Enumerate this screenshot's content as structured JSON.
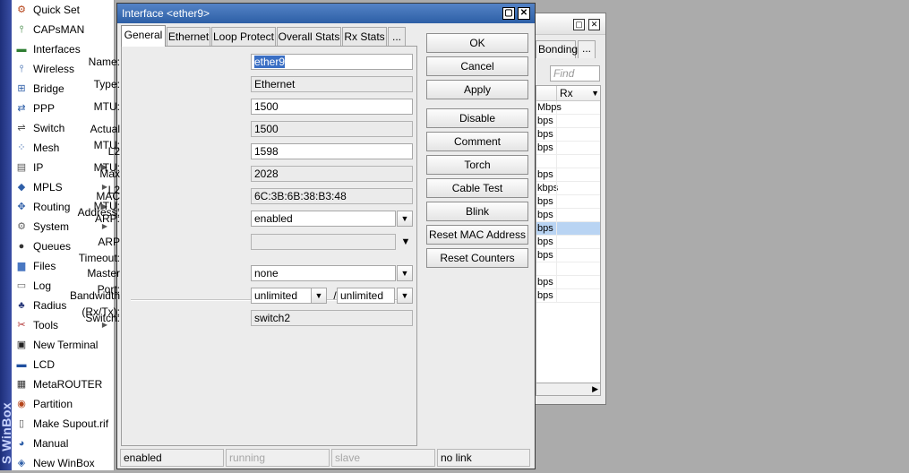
{
  "sidebar": {
    "brand": "S WinBox",
    "items": [
      {
        "label": "Quick Set",
        "icon": "quick-set-icon",
        "glyph": "⚙",
        "color": "#b5451b",
        "submenu": false
      },
      {
        "label": "CAPsMAN",
        "icon": "capsman-icon",
        "glyph": "⫯",
        "color": "#2f7d32",
        "submenu": false
      },
      {
        "label": "Interfaces",
        "icon": "interfaces-icon",
        "glyph": "▬",
        "color": "#2f7d32",
        "submenu": false
      },
      {
        "label": "Wireless",
        "icon": "wireless-icon",
        "glyph": "⫯",
        "color": "#2f5fa8",
        "submenu": false
      },
      {
        "label": "Bridge",
        "icon": "bridge-icon",
        "glyph": "⊞",
        "color": "#2f5fa8",
        "submenu": false
      },
      {
        "label": "PPP",
        "icon": "ppp-icon",
        "glyph": "⇄",
        "color": "#2f5fa8",
        "submenu": false
      },
      {
        "label": "Switch",
        "icon": "switch-icon",
        "glyph": "⇌",
        "color": "#555555",
        "submenu": false
      },
      {
        "label": "Mesh",
        "icon": "mesh-icon",
        "glyph": "⁘",
        "color": "#2f5fa8",
        "submenu": false
      },
      {
        "label": "IP",
        "icon": "ip-icon",
        "glyph": "▤",
        "color": "#555555",
        "submenu": true
      },
      {
        "label": "MPLS",
        "icon": "mpls-icon",
        "glyph": "◆",
        "color": "#2f5fa8",
        "submenu": true
      },
      {
        "label": "Routing",
        "icon": "routing-icon",
        "glyph": "✥",
        "color": "#2f5fa8",
        "submenu": true
      },
      {
        "label": "System",
        "icon": "system-icon",
        "glyph": "⚙",
        "color": "#666666",
        "submenu": true
      },
      {
        "label": "Queues",
        "icon": "queues-icon",
        "glyph": "●",
        "color": "#333333",
        "submenu": false
      },
      {
        "label": "Files",
        "icon": "files-icon",
        "glyph": "▆",
        "color": "#4a78c2",
        "submenu": false
      },
      {
        "label": "Log",
        "icon": "log-icon",
        "glyph": "▭",
        "color": "#666666",
        "submenu": false
      },
      {
        "label": "Radius",
        "icon": "radius-icon",
        "glyph": "♣",
        "color": "#2a3a7a",
        "submenu": false
      },
      {
        "label": "Tools",
        "icon": "tools-icon",
        "glyph": "✂",
        "color": "#b03030",
        "submenu": true
      },
      {
        "label": "New Terminal",
        "icon": "terminal-icon",
        "glyph": "▣",
        "color": "#222222",
        "submenu": false
      },
      {
        "label": "LCD",
        "icon": "lcd-icon",
        "glyph": "▬",
        "color": "#1f4f9f",
        "submenu": false
      },
      {
        "label": "MetaROUTER",
        "icon": "metarouter-icon",
        "glyph": "▦",
        "color": "#333333",
        "submenu": false
      },
      {
        "label": "Partition",
        "icon": "partition-icon",
        "glyph": "◉",
        "color": "#b5451b",
        "submenu": false
      },
      {
        "label": "Make Supout.rif",
        "icon": "supout-icon",
        "glyph": "▯",
        "color": "#555555",
        "submenu": false
      },
      {
        "label": "Manual",
        "icon": "manual-icon",
        "glyph": "◕",
        "color": "#2f5fa8",
        "submenu": false
      },
      {
        "label": "New WinBox",
        "icon": "winbox-icon",
        "glyph": "◈",
        "color": "#2f5fa8",
        "submenu": false
      }
    ]
  },
  "background_window": {
    "tab_label": "Bonding",
    "tab_more": "...",
    "find_placeholder": "Find",
    "column_header": "Rx",
    "rows": [
      {
        "left": "Mbps",
        "selected": false
      },
      {
        "left": "bps",
        "selected": false
      },
      {
        "left": "bps",
        "selected": false
      },
      {
        "left": "bps",
        "selected": false
      },
      {
        "left": "",
        "selected": false
      },
      {
        "left": "bps",
        "selected": false
      },
      {
        "left": "kbps",
        "selected": false
      },
      {
        "left": "bps",
        "selected": false
      },
      {
        "left": "bps",
        "selected": false
      },
      {
        "left": "bps",
        "selected": true
      },
      {
        "left": "bps",
        "selected": false
      },
      {
        "left": "bps",
        "selected": false
      },
      {
        "left": "",
        "selected": false
      },
      {
        "left": "bps",
        "selected": false
      },
      {
        "left": "bps",
        "selected": false
      }
    ]
  },
  "dialog": {
    "title": "Interface <ether9>",
    "tabs": [
      "General",
      "Ethernet",
      "Loop Protect",
      "Overall Stats",
      "Rx Stats",
      "..."
    ],
    "active_tab": "General",
    "fields": {
      "name": {
        "label": "Name:",
        "value": "ether9"
      },
      "type": {
        "label": "Type:",
        "value": "Ethernet"
      },
      "mtu": {
        "label": "MTU:",
        "value": "1500"
      },
      "actual_mtu": {
        "label": "Actual MTU:",
        "value": "1500"
      },
      "l2_mtu": {
        "label": "L2 MTU:",
        "value": "1598"
      },
      "max_l2_mtu": {
        "label": "Max L2 MTU:",
        "value": "2028"
      },
      "mac_address": {
        "label": "MAC Address:",
        "value": "6C:3B:6B:38:B3:48"
      },
      "arp": {
        "label": "ARP:",
        "value": "enabled"
      },
      "arp_timeout": {
        "label": "ARP Timeout:",
        "value": ""
      },
      "master_port": {
        "label": "Master Port:",
        "value": "none"
      },
      "bandwidth": {
        "label": "Bandwidth (Rx/Tx):",
        "rx": "unlimited",
        "tx": "unlimited",
        "separator": "/"
      },
      "switch": {
        "label": "Switch:",
        "value": "switch2"
      }
    },
    "buttons": [
      "OK",
      "Cancel",
      "Apply",
      "Disable",
      "Comment",
      "Torch",
      "Cable Test",
      "Blink",
      "Reset MAC Address",
      "Reset Counters"
    ],
    "status": [
      "enabled",
      "running",
      "slave",
      "no link"
    ]
  }
}
